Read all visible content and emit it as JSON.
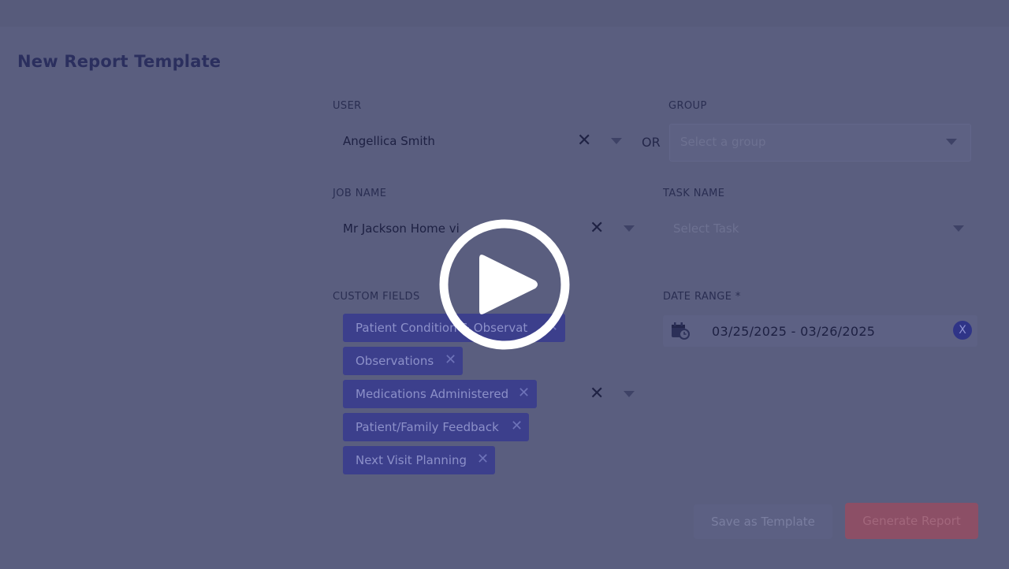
{
  "page": {
    "title": "New Report Template"
  },
  "user": {
    "label": "USER",
    "value": "Angellica Smith"
  },
  "separator": {
    "or": "OR"
  },
  "group": {
    "label": "GROUP",
    "placeholder": "Select a group"
  },
  "job": {
    "label": "JOB NAME",
    "value": "Mr Jackson Home vi"
  },
  "task": {
    "label": "TASK NAME",
    "placeholder": "Select Task"
  },
  "custom_fields": {
    "label": "CUSTOM FIELDS",
    "chips": [
      {
        "label": "Patient Condition & Observat"
      },
      {
        "label": "Observations"
      },
      {
        "label": "Medications Administered"
      },
      {
        "label": "Patient/Family Feedback"
      },
      {
        "label": "Next Visit Planning"
      }
    ]
  },
  "date_range": {
    "label": "DATE RANGE *",
    "value": "03/25/2025 - 03/26/2025",
    "clear_glyph": "X"
  },
  "actions": {
    "save_template": "Save as Template",
    "generate_report": "Generate Report"
  },
  "icons": {
    "clear": "close-icon",
    "dropdown": "chevron-down-icon",
    "calendar": "calendar-clock-icon",
    "play": "play-icon"
  },
  "glyphs": {
    "clear": "✕",
    "chip_clear": "✕"
  },
  "colors": {
    "overlay": "#5a5e7f",
    "chip": "#3c3f8c",
    "primary_button": "#8c4f66",
    "title": "#2b2f5e"
  }
}
